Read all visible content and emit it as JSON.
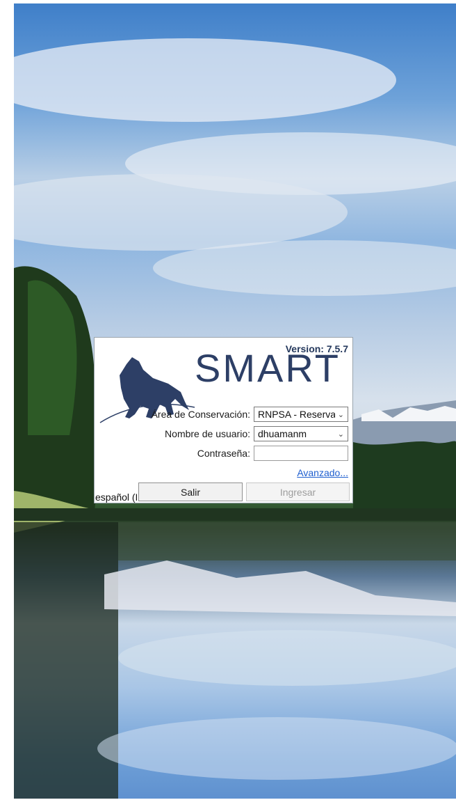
{
  "login_dialog": {
    "version": "Version: 7.5.7",
    "logo_text": "SMART",
    "conservation_area": {
      "label": "Área de Conservación:",
      "value": "RNPSA - Reserva N"
    },
    "username": {
      "label": "Nombre de usuario:",
      "value": "dhuamanm"
    },
    "password": {
      "label": "Contraseña:",
      "value": ""
    },
    "advanced_link": "Avanzado...",
    "language": "español (F",
    "exit_button": "Salir",
    "login_button": "Ingresar"
  },
  "icons": {
    "logo": "jaguar-logo-icon",
    "dropdown": "chevron-down-icon"
  },
  "colors": {
    "brand": "#2d3f66",
    "link": "#1f5fcf",
    "disabled_text": "#9d9d9d"
  }
}
